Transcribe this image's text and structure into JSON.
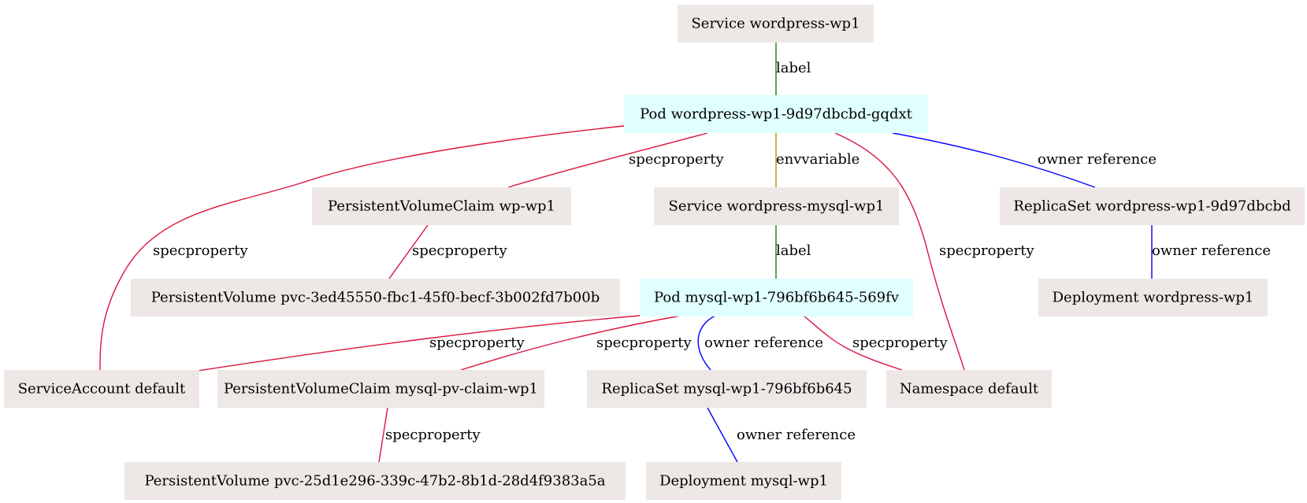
{
  "colors": {
    "pod_fill": "#e0ffff",
    "resource_fill": "#ede8e6",
    "label_edge": "#1a7a1a",
    "envvariable_edge": "#b8860b",
    "specproperty_edge": "#dc143c",
    "owner_reference_edge": "#0000ff"
  },
  "nodes": {
    "svc_wordpress": "Service wordpress-wp1",
    "pod_wordpress": "Pod wordpress-wp1-9d97dbcbd-gqdxt",
    "pvc_wp": "PersistentVolumeClaim wp-wp1",
    "svc_mysql": "Service wordpress-mysql-wp1",
    "rs_wordpress": "ReplicaSet wordpress-wp1-9d97dbcbd",
    "pv_wp": "PersistentVolume pvc-3ed45550-fbc1-45f0-becf-3b002fd7b00b",
    "pod_mysql": "Pod mysql-wp1-796bf6b645-569fv",
    "deploy_wordpress": "Deployment wordpress-wp1",
    "sa_default": "ServiceAccount default",
    "pvc_mysql": "PersistentVolumeClaim mysql-pv-claim-wp1",
    "rs_mysql": "ReplicaSet mysql-wp1-796bf6b645",
    "ns_default": "Namespace default",
    "pv_mysql": "PersistentVolume pvc-25d1e296-339c-47b2-8b1d-28d4f9383a5a",
    "deploy_mysql": "Deployment mysql-wp1"
  },
  "edges": {
    "svcwp_podwp": "label",
    "podwp_pvcwp": "specproperty",
    "podwp_svcmysql": "envvariable",
    "podwp_rswp": "owner reference",
    "podwp_sa": "specproperty",
    "podwp_ns": "specproperty",
    "pvcwp_pvwp": "specproperty",
    "svcmysql_podmysql": "label",
    "rswp_deploywp": "owner reference",
    "podmysql_sa": "specproperty",
    "podmysql_pvcmysql": "specproperty",
    "podmysql_rsmysql": "owner reference",
    "podmysql_ns": "specproperty",
    "pvcmysql_pvmysql": "specproperty",
    "rsmysql_deploymysql": "owner reference"
  }
}
